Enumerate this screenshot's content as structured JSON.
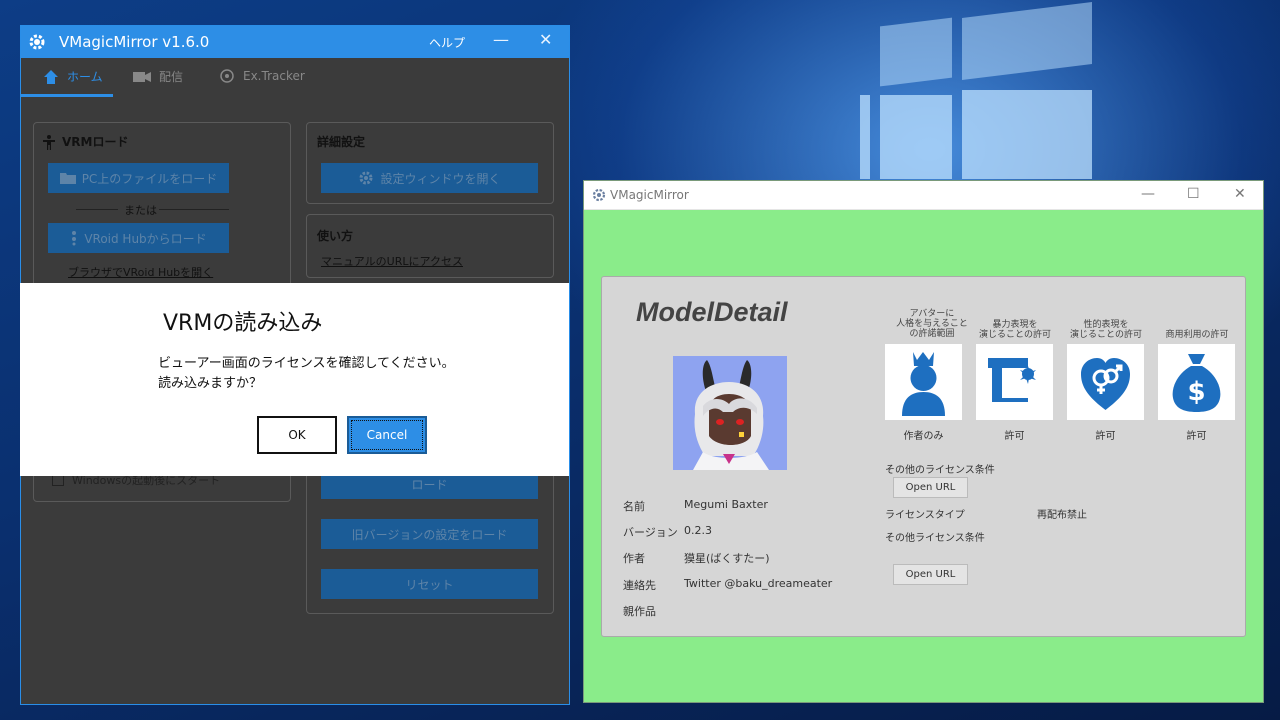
{
  "main_window": {
    "title": "VMagicMirror v1.6.0",
    "help": "ヘルプ",
    "minimize_glyph": "—",
    "close_glyph": "✕",
    "tabs": [
      {
        "label": "ホーム",
        "icon": "home-icon"
      },
      {
        "label": "配信",
        "icon": "video-camera-icon"
      },
      {
        "label": "Ex.Tracker",
        "icon": "tracker-icon"
      }
    ],
    "vrm_load": {
      "title": "VRMロード",
      "pc_file_button": "PC上のファイルをロード",
      "or_text": "または",
      "vroid_button": "VRoid Hubからロード",
      "browser_link": "ブラウザでVRoid Hubを開く",
      "windows_startup": "Windowsの起動後にスタート"
    },
    "advanced": {
      "title": "詳細設定",
      "open_settings_button": "設定ウィンドウを開く"
    },
    "usage": {
      "title": "使い方",
      "manual_link": "マニュアルのURLにアクセス"
    },
    "settings_buttons": {
      "load": "ロード",
      "load_old": "旧バージョンの設定をロード",
      "reset": "リセット"
    }
  },
  "dialog": {
    "title": "VRMの読み込み",
    "message_line1": "ビューアー画面のライセンスを確認してください。",
    "message_line2": "読み込みますか？",
    "ok": "OK",
    "cancel": "Cancel"
  },
  "detail_window": {
    "title": "VMagicMirror",
    "minimize_glyph": "—",
    "maximize_glyph": "☐",
    "close_glyph": "✕",
    "heading": "ModelDetail",
    "fields": [
      {
        "label": "名前",
        "value": "Megumi Baxter"
      },
      {
        "label": "バージョン",
        "value": "0.2.3"
      },
      {
        "label": "作者",
        "value": "獏星(ばくすたー)"
      },
      {
        "label": "連絡先",
        "value": "Twitter @baku_dreameater"
      },
      {
        "label": "親作品",
        "value": ""
      }
    ],
    "permissions": [
      {
        "label_lines": [
          "アバターに",
          "人格を与えること",
          "の許諾範囲"
        ],
        "status": "作者のみ",
        "icon": "person-crown-icon"
      },
      {
        "label_lines": [
          "暴力表現を",
          "演じることの許可"
        ],
        "status": "許可",
        "icon": "gun-icon"
      },
      {
        "label_lines": [
          "性的表現を",
          "演じることの許可"
        ],
        "status": "許可",
        "icon": "gender-heart-icon"
      },
      {
        "label_lines": [
          "商用利用の許可"
        ],
        "status": "許可",
        "icon": "money-bag-icon"
      }
    ],
    "other_license_label": "その他のライセンス条件",
    "open_url_1": "Open URL",
    "license_type_label": "ライセンスタイプ",
    "license_type_value": "再配布禁止",
    "other_license_label_2": "その他ライセンス条件",
    "open_url_2": "Open URL"
  },
  "colors": {
    "accent": "#2d8ee6",
    "detail_background": "#8aec8a",
    "icon_blue": "#1e6fc0"
  }
}
